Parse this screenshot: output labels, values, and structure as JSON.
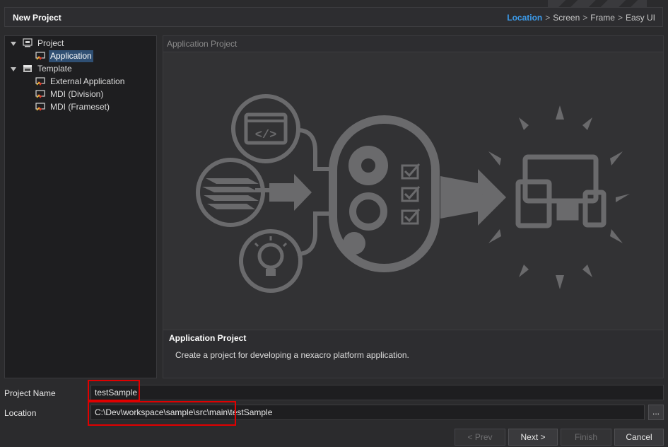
{
  "window": {
    "title": "New Project"
  },
  "wizard_steps": [
    {
      "label": "Location",
      "active": true
    },
    {
      "label": "Screen",
      "active": false
    },
    {
      "label": "Frame",
      "active": false
    },
    {
      "label": "Easy UI",
      "active": false
    }
  ],
  "step_separator": ">",
  "tree": {
    "project": {
      "label": "Project",
      "icon": "project-folder-icon",
      "expanded": true
    },
    "application": {
      "label": "Application",
      "icon": "app-template-icon",
      "selected": true
    },
    "template": {
      "label": "Template",
      "icon": "template-folder-icon",
      "expanded": true
    },
    "external_application": {
      "label": "External Application",
      "icon": "app-template-icon"
    },
    "mdi_division": {
      "label": "MDI (Division)",
      "icon": "app-template-icon"
    },
    "mdi_frameset": {
      "label": "MDI (Frameset)",
      "icon": "app-template-icon"
    }
  },
  "preview": {
    "header": "Application Project",
    "title": "Application Project",
    "description": "Create a project for developing a nexacro platform application.",
    "illustration_icons": [
      "code-icon",
      "layers-icon",
      "lightbulb-icon",
      "gears-icon",
      "checklist-icon",
      "arrow-icon",
      "devices-icon"
    ]
  },
  "form": {
    "project_name_label": "Project Name",
    "project_name_value": "testSample",
    "location_label": "Location",
    "location_value": "C:\\Dev\\workspace\\sample\\src\\main\\testSample",
    "browse_label": "..."
  },
  "buttons": {
    "prev": {
      "label": "< Prev",
      "enabled": false
    },
    "next": {
      "label": "Next >",
      "enabled": true
    },
    "finish": {
      "label": "Finish",
      "enabled": false
    },
    "cancel": {
      "label": "Cancel",
      "enabled": true
    }
  },
  "colors": {
    "accent": "#3c9bea",
    "highlight": "#e00000",
    "selection": "#2f4f73"
  }
}
